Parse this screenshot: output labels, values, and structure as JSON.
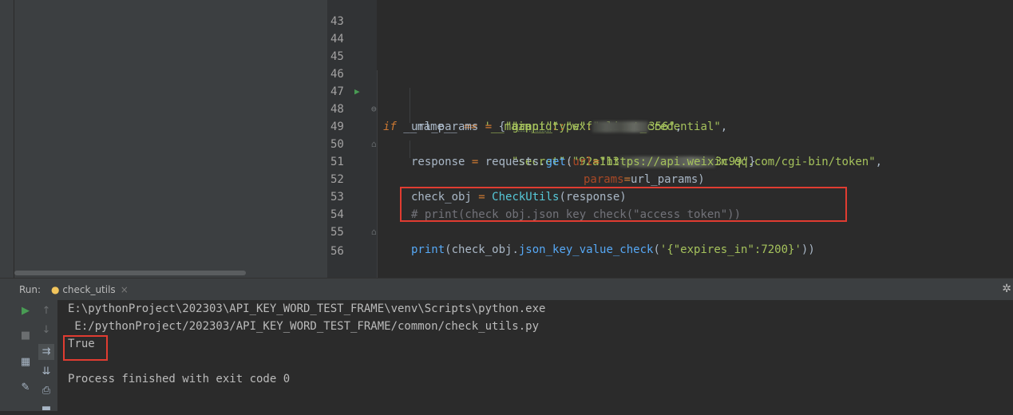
{
  "editor": {
    "lines": [
      {
        "num": "43"
      },
      {
        "num": "44"
      },
      {
        "num": "45"
      },
      {
        "num": "46"
      },
      {
        "num": "47"
      },
      {
        "num": "48"
      },
      {
        "num": "49"
      },
      {
        "num": "50"
      },
      {
        "num": "51"
      },
      {
        "num": "52"
      },
      {
        "num": "53"
      },
      {
        "num": "54"
      },
      {
        "num": "55"
      },
      {
        "num": "56"
      }
    ],
    "code": {
      "l46_if": "if",
      "l46_name": " __name__ ",
      "l46_eq": "==",
      "l46_main": " '__main__'",
      "l46_colon": ":",
      "l47_var": "url_params ",
      "l47_eq": "=",
      "l47_brace": " {",
      "l47_key": "\"grant_type\"",
      "l47_colon": ":",
      "l47_val": "\"client_credential\"",
      "l47_comma": ",",
      "l48_q": "\"",
      "l48_key": "appid",
      "l48_q2": "\"",
      "l48_colon": ":",
      "l48_val1": "\"wxf",
      "l48_val2": "356\"",
      "l48_comma": ",",
      "l49_key": "\"secret\"",
      "l49_colon": ":",
      "l49_val1": "\"92a113",
      "l49_val2": "3c99\"",
      "l49_brace": "}",
      "l50_var": "response ",
      "l50_eq": "=",
      "l50_obj": " requests.",
      "l50_fn": "get",
      "l50_paren": "(",
      "l50_param": "url",
      "l50_eq2": "=",
      "l50_url": "\"https://api.weixin.qq.com/cgi-bin/token\"",
      "l50_comma": ",",
      "l51_param": "params",
      "l51_eq": "=",
      "l51_rest": "url_params)",
      "l52_var": "check_obj ",
      "l52_eq": "=",
      "l52_cls": " CheckUtils",
      "l52_rest": "(response)",
      "l53_comment": "# print(check_obj.json_key_check(\"access_token\"))",
      "l54_fn": "print",
      "l54_p": "(check_obj.",
      "l54_m": "json_key_value_check",
      "l54_s": "'{\"expires_in\":7200}'",
      "l54_end": "))"
    }
  },
  "run_panel": {
    "label": "Run:",
    "tab_name": "check_utils",
    "output": [
      "E:\\pythonProject\\202303\\API_KEY_WORD_TEST_FRAME\\venv\\Scripts\\python.exe",
      " E:/pythonProject/202303/API_KEY_WORD_TEST_FRAME/common/check_utils.py",
      "True",
      "",
      "Process finished with exit code 0"
    ]
  },
  "colors": {
    "editor_bg": "#2b2b2b",
    "panel_bg": "#3c3f41",
    "highlight_red": "#e03c31",
    "keyword": "#cc7832",
    "string": "#a5c25c",
    "function": "#56a8f5"
  }
}
